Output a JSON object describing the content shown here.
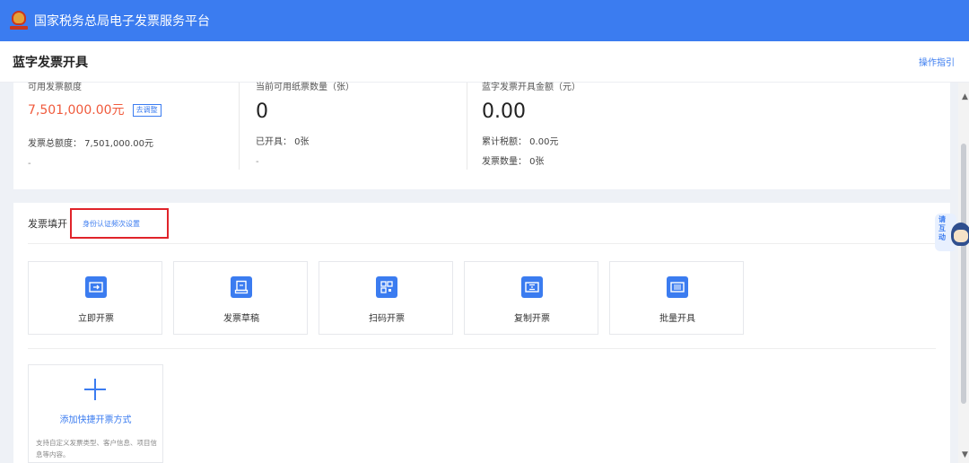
{
  "header": {
    "title": "国家税务总局电子发票服务平台"
  },
  "page": {
    "title": "蓝字发票开具",
    "guide_link": "操作指引"
  },
  "stats": {
    "col1": {
      "label": "可用发票额度",
      "value": "7,501,000.00元",
      "adjust_button": "去调整",
      "detail": "发票总额度： 7,501,000.00元",
      "dash": "-"
    },
    "col2": {
      "label": "当前可用纸票数量（张）",
      "value": "0",
      "detail": "已开具： 0张",
      "dash": "-"
    },
    "col3": {
      "label": "蓝字发票开具金额（元）",
      "value": "0.00",
      "detail1": "累计税额： 0.00元",
      "detail2": "发票数量： 0张"
    }
  },
  "invoice_fill": {
    "title": "发票填开",
    "auth_link": "身份认证频次设置",
    "tiles": [
      {
        "label": "立即开票",
        "icon": "instant-invoice-icon"
      },
      {
        "label": "发票草稿",
        "icon": "draft-icon"
      },
      {
        "label": "扫码开票",
        "icon": "qr-code-icon"
      },
      {
        "label": "复制开票",
        "icon": "copy-invoice-icon"
      },
      {
        "label": "批量开具",
        "icon": "batch-invoice-icon"
      }
    ],
    "add_quick": {
      "label": "添加快捷开票方式",
      "description": "支持自定义发票类型、客户信息、项目信息等内容。"
    }
  },
  "mascot": {
    "text": "请互动"
  },
  "colors": {
    "primary": "#3b7cf0",
    "accent_red": "#f05a3c",
    "highlight_box": "#e0232a"
  }
}
